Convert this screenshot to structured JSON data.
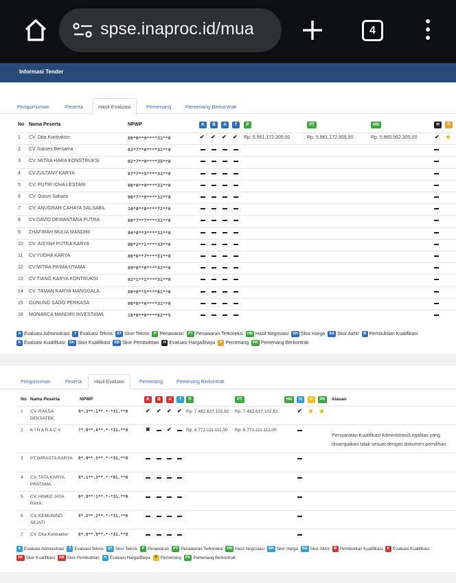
{
  "browser": {
    "url": "spse.inaproc.id/mua",
    "tab_count": "4"
  },
  "section_title": "Informasi Tender",
  "tabs": [
    "Pengumuman",
    "Peserta",
    "Hasil Evaluasi",
    "Pemenang",
    "Pemenang Berkontrak"
  ],
  "table1": {
    "headers": {
      "no": "No",
      "name": "Nama Peserta",
      "npwp": "NPWP"
    },
    "badges": [
      "K",
      "B",
      "A",
      "T",
      "P",
      "PT",
      "HN",
      "H",
      "P"
    ],
    "rows": [
      {
        "no": "1",
        "name": "CV. Dita Kontraktor",
        "npwp": "00*0**9****31**0",
        "marks": "check",
        "p": "Rp. 5.961.172.305,00",
        "pt": "Rp. 5.961.172.305,00",
        "hn": "Rp. 5.960.062.305,00",
        "h": "check",
        "star": true
      },
      {
        "no": "2",
        "name": "CV Sukses Bersama",
        "npwp": "03*7**0****31**0"
      },
      {
        "no": "3",
        "name": "CV. MITRA HARA KONSTRUKSI",
        "npwp": "02*7**0****35**0"
      },
      {
        "no": "4",
        "name": "CV.ZULTANY KARYA",
        "npwp": "07*7**5****31**0"
      },
      {
        "no": "5",
        "name": "CV. PUTRI ICHA LESTARI",
        "npwp": "00*0**9****31**0"
      },
      {
        "no": "6",
        "name": "CV. Gurun Sahara",
        "npwp": "00*7**8****31**0"
      },
      {
        "no": "7",
        "name": "CV. ANUGRAH CAHAYA SALSABIL",
        "npwp": "10*0**0****72**6"
      },
      {
        "no": "8",
        "name": "CV.DAVID DEWANTARA PUTRA",
        "npwp": "00*7**7****31**0"
      },
      {
        "no": "9",
        "name": "ZHAFIRAH MULIA MANDIRI",
        "npwp": "04*0**3****31**0"
      },
      {
        "no": "10",
        "name": "CV. AISYAH PUTRA KARYA",
        "npwp": "00*2**1****33**0"
      },
      {
        "no": "11",
        "name": "CV.YUDHA KARYA",
        "npwp": "00*6**7****31**0"
      },
      {
        "no": "12",
        "name": "CV.MITRA PRIMA UTAMA",
        "npwp": "09*8**0****31**0"
      },
      {
        "no": "13",
        "name": "CV TIANG KARYA KONTRUKSI",
        "npwp": "02*1**1****31**0"
      },
      {
        "no": "14",
        "name": "CV. TAMAN KARYA MANGGALA",
        "npwp": "00*0**5****01**0"
      },
      {
        "no": "15",
        "name": "GUNUNG SAGO PERKASA",
        "npwp": "00*0**6****31**0"
      },
      {
        "no": "16",
        "name": "MONARCA MANDIRI INVESTAMA",
        "npwp": "10*0**0****62**5"
      }
    ]
  },
  "legend1": [
    {
      "code": "A",
      "label": "Evaluasi Administrasi",
      "color": "#2e6fc1"
    },
    {
      "code": "T",
      "label": "Evaluasi Teknis",
      "color": "#2e6fc1"
    },
    {
      "code": "ST",
      "label": "Skor Teknis",
      "color": "#2e6fc1"
    },
    {
      "code": "P",
      "label": "Penawaran",
      "color": "#3aa83a"
    },
    {
      "code": "PT",
      "label": "Penawaran Terkoreksi",
      "color": "#3aa83a"
    },
    {
      "code": "HN",
      "label": "Hasil Negosiasi",
      "color": "#3aa83a"
    },
    {
      "code": "SH",
      "label": "Skor Harga",
      "color": "#2e6fc1"
    },
    {
      "code": "SA",
      "label": "Skor Akhir",
      "color": "#2e6fc1"
    },
    {
      "code": "B",
      "label": "Pembuktian Kualifikasi",
      "color": "#2e6fc1"
    },
    {
      "code": "K",
      "label": "Evaluasi Kualifikasi",
      "color": "#2e6fc1"
    },
    {
      "code": "SK",
      "label": "Skor Kualifikasi",
      "color": "#2e6fc1"
    },
    {
      "code": "SB",
      "label": "Skor Pembuktian",
      "color": "#2e6fc1"
    },
    {
      "code": "H",
      "label": "Evaluasi Harga/Biaya",
      "color": "#222222"
    },
    {
      "code": "P",
      "label": "Pemenang",
      "color": "#f0a020"
    },
    {
      "code": "PK",
      "label": "Pemenang Berkontrak",
      "color": "#3aa83a"
    }
  ],
  "table2": {
    "headers": {
      "no": "No",
      "name": "Nama Peserta",
      "npwp": "NPWP",
      "reason": "Alasan"
    },
    "badges": [
      "K",
      "B",
      "A",
      "T",
      "P",
      "PT",
      "HN",
      "H",
      "P",
      "PK"
    ],
    "rows": [
      {
        "no": "1",
        "name": "CV. RAKSA DEKSATEK",
        "npwp": "9*.3**.1**.*-*31.**0",
        "marks": "check",
        "p": "Rp. 7.482.637.102,62",
        "pt": "Rp. 7.482.637.102,62",
        "h": "check",
        "star": true,
        "reason": ""
      },
      {
        "no": "2",
        "name": "K I N A R A  C V",
        "npwp": "7*.0**.4**.*-*31.**0",
        "marks": "xcheck",
        "p": "Rp. 6.771.111.111,00",
        "pt": "Rp. 6.771.111.111,00",
        "reason": "Persyaratan Kualifikasi Administrasi/Legalitas yang disampaikan tidak sesuai dengan dokumen pemilihan"
      },
      {
        "no": "3",
        "name": "PT.WIRASTA KARYA",
        "npwp": "0*.0**.5**.*-*31.**0",
        "reason": ""
      },
      {
        "no": "4",
        "name": "CV. TATA KARYA PRATAMA",
        "npwp": "8*.1**.3**.*-*01.**0",
        "reason": ""
      },
      {
        "no": "5",
        "name": "CV. HINKO JAYA RAYA",
        "npwp": "0*.8**.1**.*-*31.**0",
        "reason": ""
      },
      {
        "no": "6",
        "name": "CV. KEMUNING SEJATI",
        "npwp": "8*.2**.2**.*-*31.**0",
        "reason": ""
      },
      {
        "no": "7",
        "name": "CV. Dita Kontraktor",
        "npwp": "0*.0**.9**.*-*31.**0",
        "reason": ""
      }
    ]
  },
  "legend2": [
    {
      "code": "A",
      "label": "Evaluasi Administrasi",
      "color": "#2ea0d8"
    },
    {
      "code": "T",
      "label": "Evaluasi Teknis",
      "color": "#2ea0d8"
    },
    {
      "code": "ST",
      "label": "Skor Teknis",
      "color": "#2ea0d8"
    },
    {
      "code": "P",
      "label": "Penawaran",
      "color": "#3aa83a"
    },
    {
      "code": "PT",
      "label": "Penawaran Terkoreksi",
      "color": "#3aa83a"
    },
    {
      "code": "HN",
      "label": "Hasil Negosiasi",
      "color": "#3aa83a"
    },
    {
      "code": "SH",
      "label": "Skor Harga",
      "color": "#2ea0d8"
    },
    {
      "code": "SA",
      "label": "Skor Akhir",
      "color": "#2ea0d8"
    },
    {
      "code": "B",
      "label": "Pembuktian Kualifikasi",
      "color": "#d9322e"
    },
    {
      "code": "K",
      "label": "Evaluasi Kualifikasi",
      "color": "#d9322e"
    },
    {
      "code": "SK",
      "label": "Skor Kualifikasi",
      "color": "#d9322e"
    },
    {
      "code": "SB",
      "label": "Skor Pembuktian",
      "color": "#d9322e"
    },
    {
      "code": "H",
      "label": "Evaluasi Harga/Biaya",
      "color": "#2ea0d8"
    },
    {
      "code": "P",
      "label": "Pemenang",
      "color": "#f0c020"
    },
    {
      "code": "PK",
      "label": "Pemenang Berkontrak",
      "color": "#3aa83a"
    }
  ]
}
